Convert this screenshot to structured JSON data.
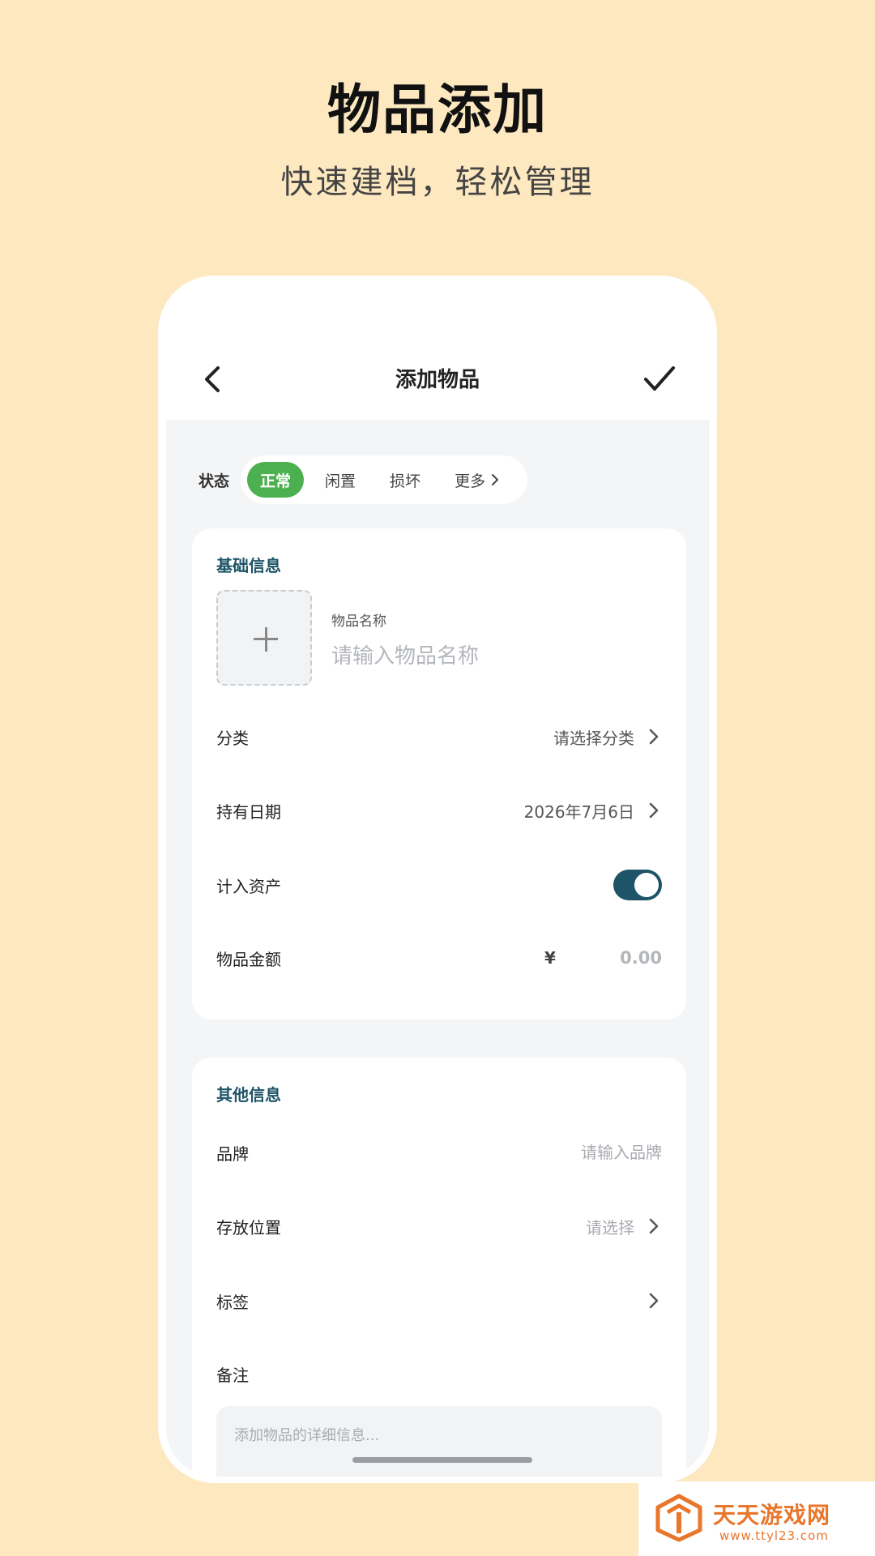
{
  "hero": {
    "title": "物品添加",
    "subtitle": "快速建档，轻松管理"
  },
  "navbar": {
    "title": "添加物品",
    "back_icon": "chevron-left-icon",
    "confirm_icon": "check-icon"
  },
  "status": {
    "label": "状态",
    "chips": [
      "正常",
      "闲置",
      "损坏",
      "更多"
    ],
    "selected": "正常",
    "active_color": "#4CAF50"
  },
  "basic_info": {
    "title": "基础信息",
    "photo_icon": "plus-icon",
    "name_label": "物品名称",
    "name_placeholder": "请输入物品名称",
    "category": {
      "label": "分类",
      "value": "请选择分类"
    },
    "hold_date": {
      "label": "持有日期",
      "value": "2026年7月6日"
    },
    "count_as_asset": {
      "label": "计入资产",
      "on": true
    },
    "amount": {
      "label": "物品金额",
      "currency": "¥",
      "placeholder": "0.00"
    }
  },
  "other_info": {
    "title": "其他信息",
    "brand": {
      "label": "品牌",
      "placeholder": "请输入品牌"
    },
    "location": {
      "label": "存放位置",
      "value": "请选择"
    },
    "tags": {
      "label": "标签"
    },
    "notes": {
      "label": "备注",
      "placeholder": "添加物品的详细信息..."
    }
  },
  "watermark": {
    "name": "天天游戏网",
    "url": "www.ttyl23.com"
  },
  "colors": {
    "background": "#FDE8C0",
    "accent": "#1E5468"
  }
}
